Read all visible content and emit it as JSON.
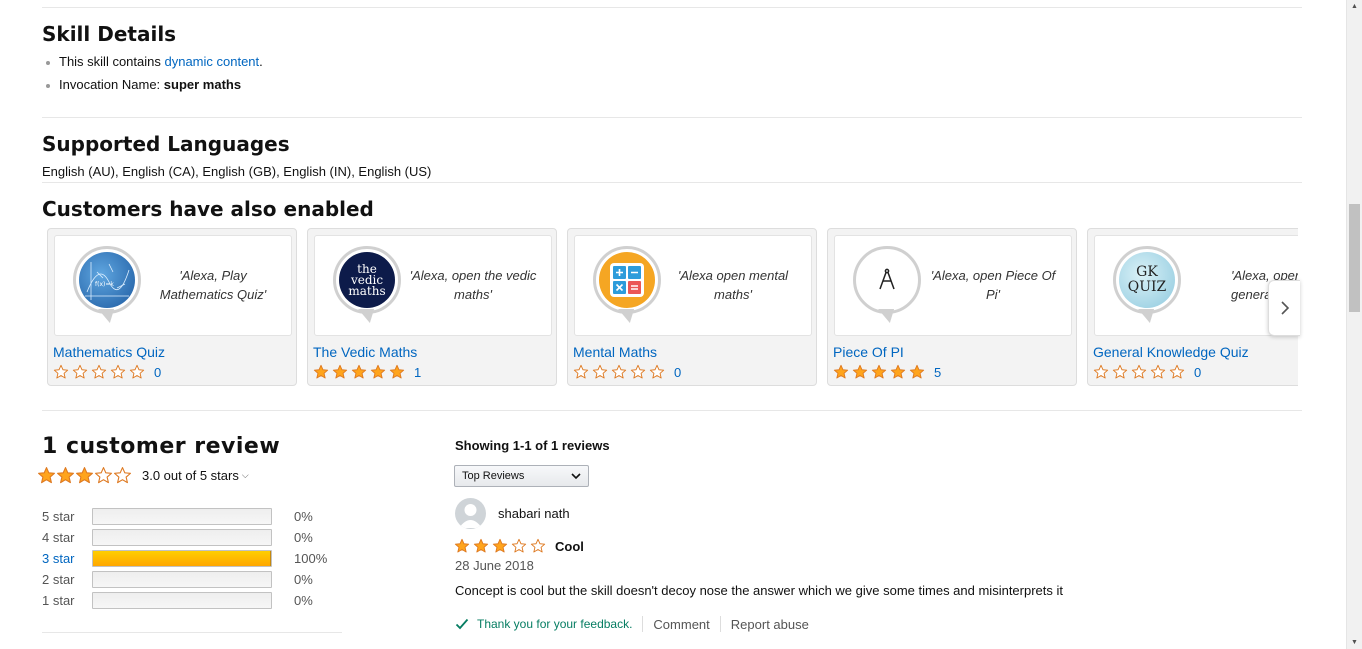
{
  "skill_details": {
    "heading": "Skill Details",
    "dynamic_prefix": "This skill contains ",
    "dynamic_link": "dynamic content",
    "dynamic_suffix": ".",
    "invocation_label": "Invocation Name: ",
    "invocation_value": "super maths"
  },
  "languages": {
    "heading": "Supported Languages",
    "list": "English (AU), English (CA), English (GB), English (IN), English (US)"
  },
  "also_enabled": {
    "heading": "Customers have also enabled",
    "cards": [
      {
        "title": "Mathematics Quiz",
        "quote": "'Alexa, Play Mathematics Quiz'",
        "rating": 0,
        "count": "0",
        "icon": "math-quiz-icon"
      },
      {
        "title": "The Vedic Maths",
        "quote": "'Alexa, open the vedic maths'",
        "rating": 5,
        "count": "1",
        "icon": "vedic-maths-icon",
        "icon_text": "the vedic maths"
      },
      {
        "title": "Mental Maths",
        "quote": "'Alexa open mental maths'",
        "rating": 0,
        "count": "0",
        "icon": "calculator-icon"
      },
      {
        "title": "Piece Of PI",
        "quote": "'Alexa, open Piece Of Pi'",
        "rating": 5,
        "count": "5",
        "icon": "compass-icon"
      },
      {
        "title": "General Knowledge Quiz",
        "quote": "'Alexa, open general knowledge",
        "rating": 0,
        "count": "0",
        "icon": "gk-quiz-icon",
        "icon_text": "GK QUIZ"
      }
    ]
  },
  "reviews_summary": {
    "title": "1 customer review",
    "average": 3,
    "average_text": "3.0 out of 5 stars",
    "histogram": [
      {
        "label": "5 star",
        "pct": 0,
        "pct_text": "0%"
      },
      {
        "label": "4 star",
        "pct": 0,
        "pct_text": "0%"
      },
      {
        "label": "3 star",
        "pct": 100,
        "pct_text": "100%"
      },
      {
        "label": "2 star",
        "pct": 0,
        "pct_text": "0%"
      },
      {
        "label": "1 star",
        "pct": 0,
        "pct_text": "0%"
      }
    ]
  },
  "reviews_list": {
    "showing": "Showing 1-1 of 1 reviews",
    "sort_value": "Top Reviews",
    "review": {
      "author": "shabari nath",
      "rating": 3,
      "title": "Cool",
      "date": "28 June 2018",
      "body": "Concept is cool but the skill doesn't decoy nose the answer which we give some times and misinterprets it",
      "feedback": "Thank you for your feedback.",
      "comment": "Comment",
      "report": "Report abuse"
    }
  },
  "colors": {
    "link": "#0066c0",
    "star": "#ffa41c",
    "bar_fill": "#ffa700",
    "feedback": "#067d62"
  }
}
